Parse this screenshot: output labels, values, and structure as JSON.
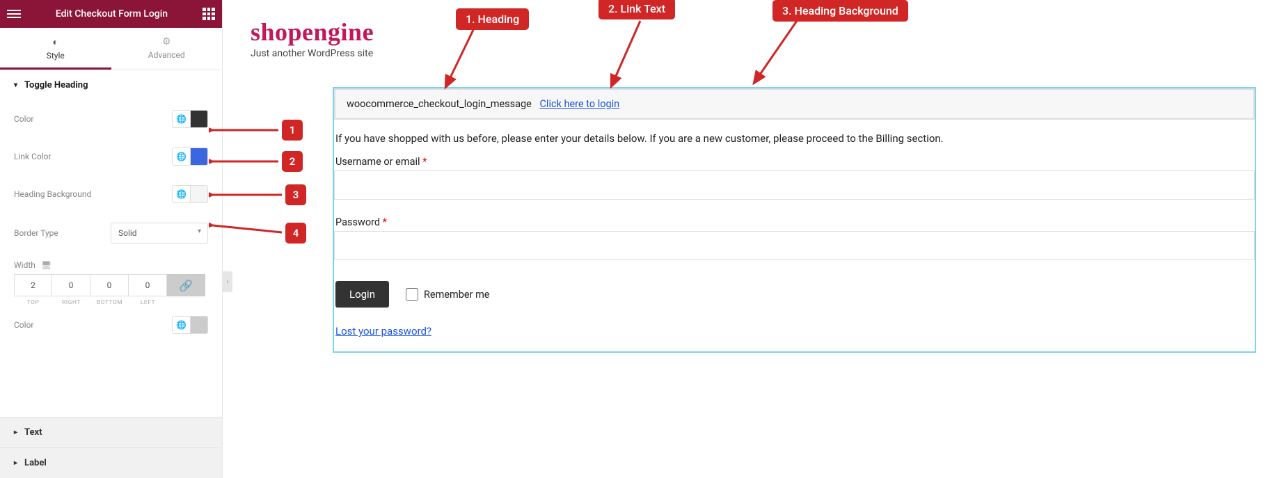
{
  "panel": {
    "title": "Edit Checkout Form Login",
    "tabs": {
      "style": "Style",
      "advanced": "Advanced"
    },
    "section_toggle_heading": "Toggle Heading",
    "controls": {
      "color": "Color",
      "link_color": "Link Color",
      "heading_bg": "Heading Background",
      "border_type": "Border Type",
      "border_type_value": "Solid",
      "width": "Width",
      "width_values": {
        "top": "2",
        "right": "0",
        "bottom": "0",
        "left": "0"
      },
      "width_labels": {
        "top": "TOP",
        "right": "RIGHT",
        "bottom": "BOTTOM",
        "left": "LEFT"
      },
      "color2": "Color"
    },
    "swatches": {
      "color": "#333333",
      "link_color": "#3a66e0",
      "heading_bg": "#f7f7f7",
      "border_color": "#cccccc"
    },
    "accordion": {
      "text": "Text",
      "label": "Label"
    }
  },
  "site": {
    "title": "shopengine",
    "tagline": "Just another WordPress site"
  },
  "checkout": {
    "toggle_message": "woocommerce_checkout_login_message",
    "toggle_link": "Click here to login",
    "intro": "If you have shopped with us before, please enter your details below. If you are a new customer, please proceed to the Billing section.",
    "username_label": "Username or email ",
    "password_label": "Password ",
    "login_button": "Login",
    "remember": "Remember me",
    "lost_password": "Lost your password?"
  },
  "annotations": {
    "heading": "1. Heading",
    "link_text": "2. Link Text",
    "heading_bg": "3. Heading Background",
    "n1": "1",
    "n2": "2",
    "n3": "3",
    "n4": "4"
  }
}
